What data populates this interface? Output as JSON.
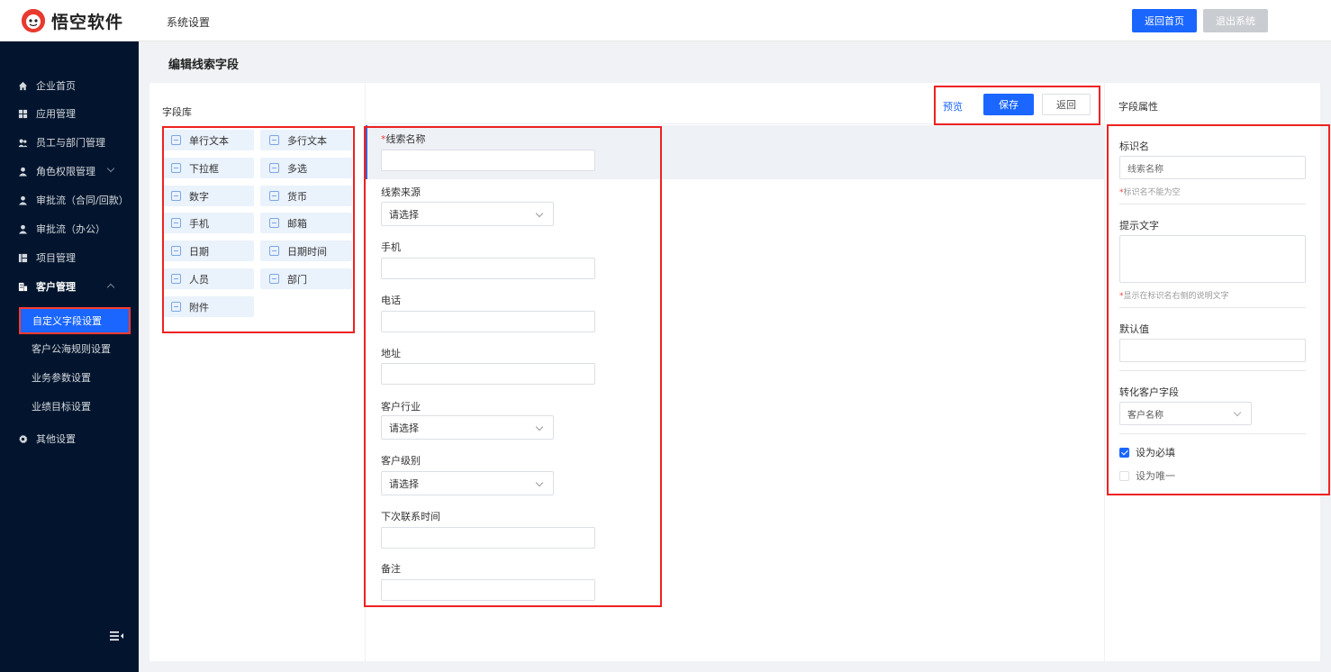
{
  "header": {
    "logo_text": "悟空软件",
    "nav_title": "系统设置",
    "home_button": "返回首页",
    "exit_button": "退出系统"
  },
  "sidebar": {
    "items": [
      {
        "label": "企业首页",
        "icon": "home-icon"
      },
      {
        "label": "应用管理",
        "icon": "grid-icon"
      },
      {
        "label": "员工与部门管理",
        "icon": "users-icon"
      },
      {
        "label": "角色权限管理",
        "icon": "user-icon"
      },
      {
        "label": "审批流（合同/回款）",
        "icon": "user-icon"
      },
      {
        "label": "审批流（办公）",
        "icon": "user-icon"
      },
      {
        "label": "项目管理",
        "icon": "board-icon"
      },
      {
        "label": "客户管理",
        "icon": "building-icon"
      }
    ],
    "sub_items": [
      {
        "label": "自定义字段设置"
      },
      {
        "label": "客户公海规则设置"
      },
      {
        "label": "业务参数设置"
      },
      {
        "label": "业绩目标设置"
      }
    ],
    "other": {
      "label": "其他设置",
      "icon": "gear-icon"
    }
  },
  "page": {
    "title": "编辑线索字段"
  },
  "library": {
    "title": "字段库",
    "fields": [
      {
        "label": "单行文本",
        "icon": "single-line-text-icon"
      },
      {
        "label": "多行文本",
        "icon": "multi-line-text-icon"
      },
      {
        "label": "下拉框",
        "icon": "dropdown-icon"
      },
      {
        "label": "多选",
        "icon": "multi-select-icon"
      },
      {
        "label": "数字",
        "icon": "number-icon"
      },
      {
        "label": "货币",
        "icon": "currency-icon"
      },
      {
        "label": "手机",
        "icon": "phone-icon"
      },
      {
        "label": "邮箱",
        "icon": "email-icon"
      },
      {
        "label": "日期",
        "icon": "date-icon"
      },
      {
        "label": "日期时间",
        "icon": "datetime-icon"
      },
      {
        "label": "人员",
        "icon": "person-icon"
      },
      {
        "label": "部门",
        "icon": "department-icon"
      },
      {
        "label": "附件",
        "icon": "attachment-icon"
      }
    ]
  },
  "form": {
    "preview_link": "预览",
    "save_button": "保存",
    "back_button": "返回",
    "fields": [
      {
        "label": "线索名称",
        "required": "*",
        "type": "input"
      },
      {
        "label": "线索来源",
        "type": "select",
        "placeholder": "请选择"
      },
      {
        "label": "手机",
        "type": "input"
      },
      {
        "label": "电话",
        "type": "input"
      },
      {
        "label": "地址",
        "type": "input"
      },
      {
        "label": "客户行业",
        "type": "select",
        "placeholder": "请选择"
      },
      {
        "label": "客户级别",
        "type": "select",
        "placeholder": "请选择"
      },
      {
        "label": "下次联系时间",
        "type": "input"
      },
      {
        "label": "备注",
        "type": "input"
      }
    ]
  },
  "properties": {
    "title": "字段属性",
    "name_label": "标识名",
    "name_value": "线索名称",
    "name_hint_star": "*",
    "name_hint": "标识名不能为空",
    "tip_label": "提示文字",
    "tip_hint_star": "*",
    "tip_hint": "显示在标识名右侧的说明文字",
    "default_label": "默认值",
    "convert_label": "转化客户字段",
    "convert_value": "客户名称",
    "required_label": "设为必填",
    "required_checked": true,
    "unique_label": "设为唯一",
    "unique_checked": false
  }
}
